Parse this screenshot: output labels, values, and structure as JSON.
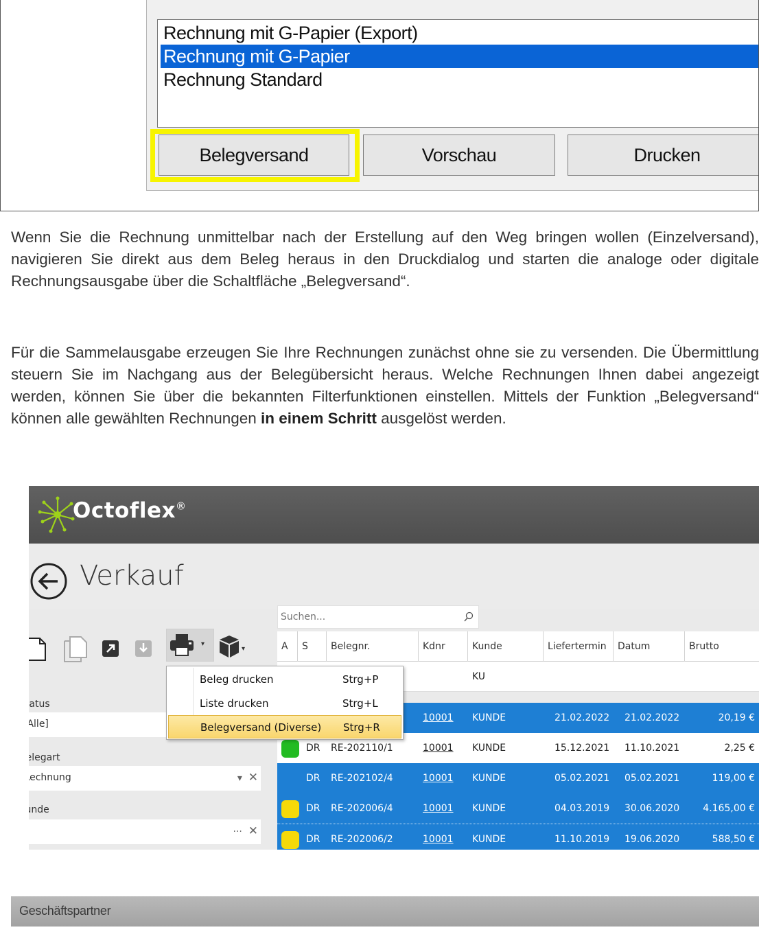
{
  "dialog": {
    "report_list": [
      {
        "label": "Rechnung mit G-Papier (Export)",
        "selected": false
      },
      {
        "label": "Rechnung mit G-Papier",
        "selected": true
      },
      {
        "label": "Rechnung Standard",
        "selected": false
      }
    ],
    "buttons": {
      "belegversand": "Belegversand",
      "vorschau": "Vorschau",
      "drucken": "Drucken"
    },
    "highlight_color": "#f7f400"
  },
  "text": {
    "para1": "Wenn Sie die Rechnung unmittelbar nach der Erstellung auf den Weg bringen wollen (Einzelversand), navigieren Sie direkt aus dem Beleg heraus in den Druckdialog und starten die analoge oder digitale Rechnungsausgabe über die Schaltfläche „Belegversand“.",
    "para2_a": "Für die Sammelausgabe erzeugen Sie Ihre Rechnungen zunächst ohne sie zu versenden. Die Übermittlung steuern Sie im Nachgang aus der Belegübersicht heraus. Welche Rechnungen Ihnen dabei angezeigt werden, können Sie über die bekannten Filterfunktionen einstellen. Mittels der Funktion „Belegversand“ können alle gewählten Rechnungen ",
    "para2_bold": "in einem Schritt",
    "para2_b": " ausgelöst werden."
  },
  "app": {
    "name": "Octoflex",
    "trademark": "®",
    "page_title": "Verkauf",
    "search_placeholder": "Suchen...",
    "accent_color": "#1e7fd4",
    "filters": {
      "status_label": "Status",
      "status_value": "[Alle]",
      "belegart_label": "Belegart",
      "belegart_value": "Rechnung",
      "kunde_label": "Kunde",
      "kunde_value": ""
    },
    "menu": [
      {
        "label": "Beleg drucken",
        "shortcut": "Strg+P",
        "highlighted": false
      },
      {
        "label": "Liste drucken",
        "shortcut": "Strg+L",
        "highlighted": false
      },
      {
        "label": "Belegversand (Diverse)",
        "shortcut": "Strg+R",
        "highlighted": true
      }
    ],
    "columns": [
      "A",
      "S",
      "Belegnr.",
      "Kdnr",
      "Kunde",
      "Liefertermin",
      "Datum",
      "Brutto"
    ],
    "filter_row": {
      "kunde": "KU"
    },
    "rows": [
      {
        "status": "",
        "s": "",
        "belegnr": "",
        "kdnr": "10001",
        "kunde": "KUNDE",
        "liefertermin": "21.02.2022",
        "datum": "21.02.2022",
        "brutto": "20,19 €",
        "selected": true,
        "dot": ""
      },
      {
        "status": "green",
        "s": "DR",
        "belegnr": "RE-202110/1",
        "kdnr": "10001",
        "kunde": "KUNDE",
        "liefertermin": "15.12.2021",
        "datum": "11.10.2021",
        "brutto": "2,25 €",
        "selected": false,
        "dot": "#22bb22"
      },
      {
        "status": "",
        "s": "DR",
        "belegnr": "RE-202102/4",
        "kdnr": "10001",
        "kunde": "KUNDE",
        "liefertermin": "05.02.2021",
        "datum": "05.02.2021",
        "brutto": "119,00 €",
        "selected": true,
        "dot": ""
      },
      {
        "status": "yellow",
        "s": "DR",
        "belegnr": "RE-202006/4",
        "kdnr": "10001",
        "kunde": "KUNDE",
        "liefertermin": "04.03.2019",
        "datum": "30.06.2020",
        "brutto": "4.165,00 €",
        "selected": true,
        "dot": "#f5d90a"
      },
      {
        "status": "yellow",
        "s": "DR",
        "belegnr": "RE-202006/2",
        "kdnr": "10001",
        "kunde": "KUNDE",
        "liefertermin": "11.10.2019",
        "datum": "19.06.2020",
        "brutto": "588,50 €",
        "selected": true,
        "dot": "#f5d90a"
      }
    ]
  },
  "bottom": {
    "section_label": "Geschäftspartner"
  }
}
